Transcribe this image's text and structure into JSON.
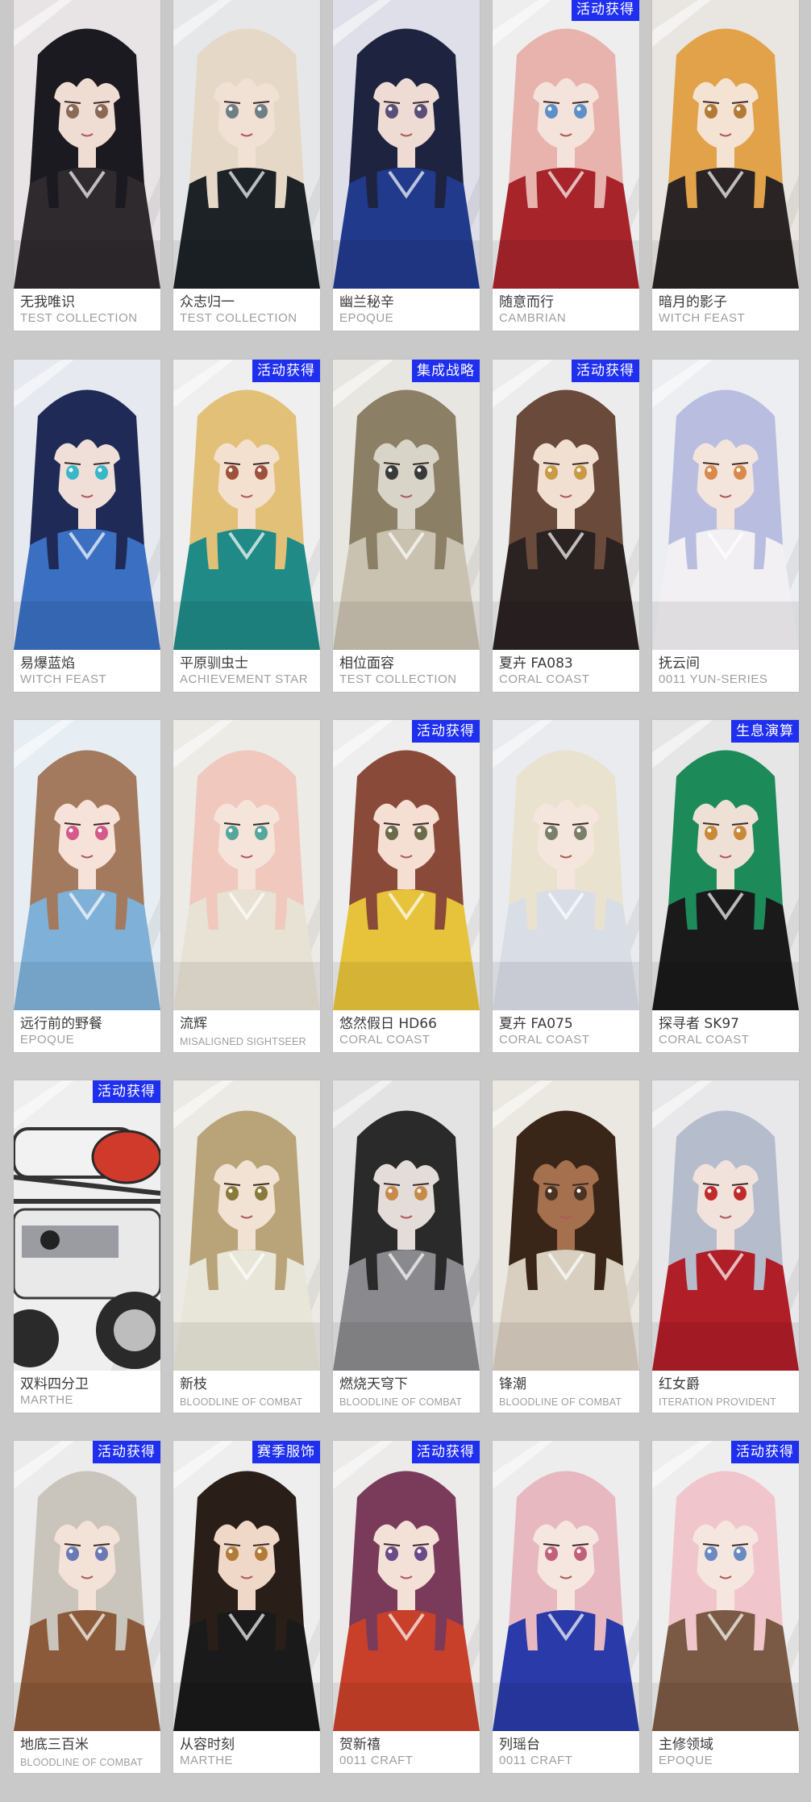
{
  "cards": [
    {
      "name_cn": "无我唯识",
      "series": "TEST COLLECTION",
      "badge": "",
      "hair": "#1b1a20",
      "skin": "#efdcd2",
      "outfit": "#2e2a2e",
      "eye": "#8a6a55",
      "bg": "#e8e4e6"
    },
    {
      "name_cn": "众志归一",
      "series": "TEST COLLECTION",
      "badge": "",
      "hair": "#e6d8c6",
      "skin": "#f1e0d4",
      "outfit": "#1d2226",
      "eye": "#6f7f86",
      "bg": "#e5e7e8"
    },
    {
      "name_cn": "幽兰秘辛",
      "series": "EPOQUE",
      "badge": "",
      "hair": "#1e2340",
      "skin": "#eedcd4",
      "outfit": "#223a8c",
      "eye": "#5a4f78",
      "bg": "#dedfe8"
    },
    {
      "name_cn": "随意而行",
      "series": "CAMBRIAN",
      "badge": "活动获得",
      "hair": "#e8b3ad",
      "skin": "#f4e3da",
      "outfit": "#a8242b",
      "eye": "#5f8fc8",
      "bg": "#eeeeee"
    },
    {
      "name_cn": "暗月的影子",
      "series": "WITCH FEAST",
      "badge": "",
      "hair": "#e1a24a",
      "skin": "#f4e2d2",
      "outfit": "#2a2424",
      "eye": "#b27a34",
      "bg": "#e9e6e2"
    },
    {
      "name_cn": "易爆蓝焰",
      "series": "WITCH FEAST",
      "badge": "",
      "hair": "#1f2a56",
      "skin": "#f0dfd8",
      "outfit": "#3a6fc2",
      "eye": "#39b7c9",
      "bg": "#e6e9ef"
    },
    {
      "name_cn": "平原驯虫士",
      "series": "ACHIEVEMENT STAR",
      "badge": "活动获得",
      "hair": "#e2c077",
      "skin": "#f3e0cf",
      "outfit": "#1f8a86",
      "eye": "#a0513a",
      "bg": "#efefef"
    },
    {
      "name_cn": "相位面容",
      "series": "TEST COLLECTION",
      "badge": "集成战略",
      "hair": "#8b7f66",
      "skin": "#d9d4c8",
      "outfit": "#c9c2b0",
      "eye": "#3a3a3a",
      "bg": "#e8e6e0"
    },
    {
      "name_cn": "夏卉 FA083",
      "series": "CORAL COAST",
      "badge": "活动获得",
      "hair": "#6a4a3a",
      "skin": "#f1dfd2",
      "outfit": "#2b2222",
      "eye": "#c79a43",
      "bg": "#ececec"
    },
    {
      "name_cn": "抚云间",
      "series": "0011 YUN-SERIES",
      "badge": "",
      "hair": "#b9bde0",
      "skin": "#f3e4dc",
      "outfit": "#f2f0f2",
      "eye": "#d98a4a",
      "bg": "#eceef2"
    },
    {
      "name_cn": "远行前的野餐",
      "series": "EPOQUE",
      "badge": "",
      "hair": "#a37a5e",
      "skin": "#f6e2d8",
      "outfit": "#7fb0d8",
      "eye": "#d25b8a",
      "bg": "#e7eef3"
    },
    {
      "name_cn": "流辉",
      "series": "MISALIGNED SIGHTSEER",
      "badge": "",
      "hair": "#f0c8bd",
      "skin": "#f5e4da",
      "outfit": "#e8e2d4",
      "eye": "#55a69c",
      "bg": "#ecebe6",
      "small": true
    },
    {
      "name_cn": "悠然假日 HD66",
      "series": "CORAL COAST",
      "badge": "活动获得",
      "hair": "#8a4a3a",
      "skin": "#f4dfd2",
      "outfit": "#e6c33a",
      "eye": "#6b6a4a",
      "bg": "#eeeeee"
    },
    {
      "name_cn": "夏卉 FA075",
      "series": "CORAL COAST",
      "badge": "",
      "hair": "#e8e2cf",
      "skin": "#f4e6dc",
      "outfit": "#d9dde6",
      "eye": "#7a7f6a",
      "bg": "#e9ebef"
    },
    {
      "name_cn": "探寻者 SK97",
      "series": "CORAL COAST",
      "badge": "生息演算",
      "hair": "#1d8a5a",
      "skin": "#efe0d6",
      "outfit": "#1a1a1a",
      "eye": "#c88a3a",
      "bg": "#e6e6e6"
    },
    {
      "name_cn": "双料四分卫",
      "series": "MARTHE",
      "badge": "活动获得",
      "hair": "#3a3a3a",
      "skin": "#d8d8d8",
      "outfit": "#8f9094",
      "eye": "#333333",
      "bg": "#efefef",
      "machine": true
    },
    {
      "name_cn": "新枝",
      "series": "BLOODLINE OF COMBAT",
      "badge": "",
      "hair": "#b8a478",
      "skin": "#f2e2d4",
      "outfit": "#e8e6d8",
      "eye": "#8a7a3a",
      "bg": "#eceae4",
      "small": true
    },
    {
      "name_cn": "燃烧天穹下",
      "series": "BLOODLINE OF COMBAT",
      "badge": "",
      "hair": "#2a2a2a",
      "skin": "#e4dcd8",
      "outfit": "#8a8a8e",
      "eye": "#c88a4a",
      "bg": "#e3e3e3",
      "small": true
    },
    {
      "name_cn": "锋潮",
      "series": "BLOODLINE OF COMBAT",
      "badge": "",
      "hair": "#3a2618",
      "skin": "#a4704e",
      "outfit": "#d8cfc0",
      "eye": "#4a3322",
      "bg": "#ebe8e2",
      "small": true
    },
    {
      "name_cn": "红女爵",
      "series": "ITERATION PROVIDENT",
      "badge": "",
      "hair": "#b5bccc",
      "skin": "#f1e2dc",
      "outfit": "#b01e28",
      "eye": "#c22a2a",
      "bg": "#e8e8ea",
      "small": true
    },
    {
      "name_cn": "地底三百米",
      "series": "BLOODLINE OF COMBAT",
      "badge": "活动获得",
      "hair": "#c9c4bc",
      "skin": "#f3e2d8",
      "outfit": "#8a5a3a",
      "eye": "#6a7ab4",
      "bg": "#ececec",
      "small": true
    },
    {
      "name_cn": "从容时刻",
      "series": "MARTHE",
      "badge": "赛季服饰",
      "hair": "#2a1e18",
      "skin": "#efd8c8",
      "outfit": "#1a1a1a",
      "eye": "#b47a3a",
      "bg": "#eeeeee"
    },
    {
      "name_cn": "贺新禧",
      "series": "0011 CRAFT",
      "badge": "活动获得",
      "hair": "#7a3a5a",
      "skin": "#f3e0d6",
      "outfit": "#c8402a",
      "eye": "#6a4a8a",
      "bg": "#ecebea"
    },
    {
      "name_cn": "列瑶台",
      "series": "0011 CRAFT",
      "badge": "",
      "hair": "#e8b8c0",
      "skin": "#f5e6e0",
      "outfit": "#2a3aa8",
      "eye": "#c2607a",
      "bg": "#ededee"
    },
    {
      "name_cn": "主修领域",
      "series": "EPOQUE",
      "badge": "活动获得",
      "hair": "#f0c6cc",
      "skin": "#f6e6e0",
      "outfit": "#7a5a44",
      "eye": "#6a8ac2",
      "bg": "#efeeee"
    }
  ]
}
